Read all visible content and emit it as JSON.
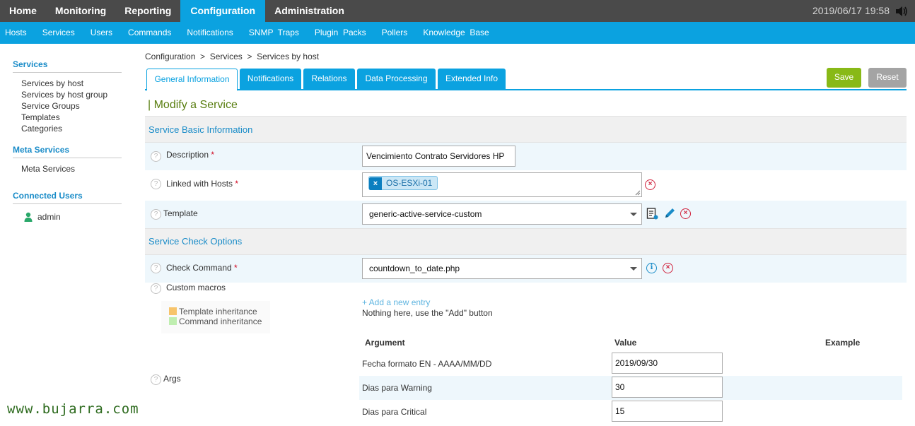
{
  "topnav": {
    "items": [
      "Home",
      "Monitoring",
      "Reporting",
      "Configuration",
      "Administration"
    ],
    "active": "Configuration",
    "clock": "2019/06/17 19:58"
  },
  "subnav": {
    "items": [
      "Hosts",
      "Services",
      "Users",
      "Commands",
      "Notifications",
      "SNMP  Traps",
      "Plugin  Packs",
      "Pollers",
      "Knowledge  Base"
    ]
  },
  "sidebar": {
    "services_head": "Services",
    "services_links": [
      "Services by host",
      "Services by host group",
      "Service Groups",
      "Templates",
      "Categories"
    ],
    "meta_head": "Meta Services",
    "meta_links": [
      "Meta Services"
    ],
    "users_head": "Connected Users",
    "user": "admin",
    "watermark": "www.bujarra.com"
  },
  "breadcrumb": "Configuration  >  Services  >  Services by host",
  "tabs": [
    "General Information",
    "Notifications",
    "Relations",
    "Data Processing",
    "Extended Info"
  ],
  "buttons": {
    "save": "Save",
    "reset": "Reset"
  },
  "form": {
    "title": "| Modify a Service",
    "section_basic": "Service Basic Information",
    "description_label": "Description",
    "description_value": "Vencimiento Contrato Servidores HP",
    "hosts_label": "Linked with Hosts",
    "host_chip": "OS-ESXi-01",
    "template_label": "Template",
    "template_value": "generic-active-service-custom",
    "section_check": "Service Check Options",
    "check_command_label": "Check Command",
    "check_command_value": "countdown_to_date.php",
    "custom_macros_label": "Custom macros",
    "legend_template": "Template inheritance",
    "legend_command": "Command inheritance",
    "add_entry": "+ Add a new entry",
    "nothing_here": "Nothing here, use the \"Add\" button",
    "args_label": "Args",
    "args_headers": {
      "argument": "Argument",
      "value": "Value",
      "example": "Example"
    },
    "args": [
      {
        "name": "Fecha formato EN - AAAA/MM/DD",
        "value": "2019/09/30"
      },
      {
        "name": "Dias para Warning",
        "value": "30"
      },
      {
        "name": "Dias para Critical",
        "value": "15"
      }
    ],
    "required_mark": "*"
  },
  "colors": {
    "topbar": "#4a4a4a",
    "accent": "#0ba2e0",
    "save": "#88b917",
    "reset": "#a4a4a4",
    "title": "#587d0f"
  }
}
